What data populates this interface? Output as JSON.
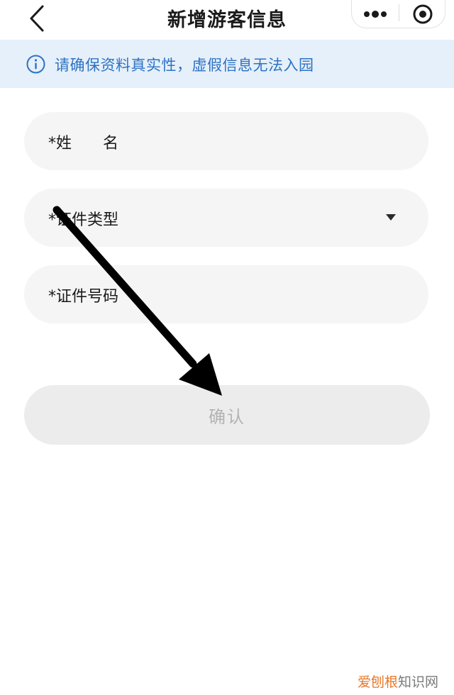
{
  "nav": {
    "title": "新增游客信息",
    "back_icon": "chevron-left-icon",
    "more_icon": "more-dots-icon",
    "close_icon": "target-circle-icon"
  },
  "notice": {
    "icon": "info-icon",
    "text": "请确保资料真实性，虚假信息无法入园",
    "color": "#2d72c4",
    "background": "#e6f0fa"
  },
  "form": {
    "name_label": "*姓　　名",
    "id_type_label": "*证件类型",
    "id_number_label": "*证件号码",
    "dropdown_icon": "triangle-down-icon"
  },
  "confirm": {
    "label": "确认"
  },
  "annotation": {
    "arrow_color": "#000000"
  },
  "watermark": {
    "brand": "爱刨根",
    "site": "知识网"
  }
}
